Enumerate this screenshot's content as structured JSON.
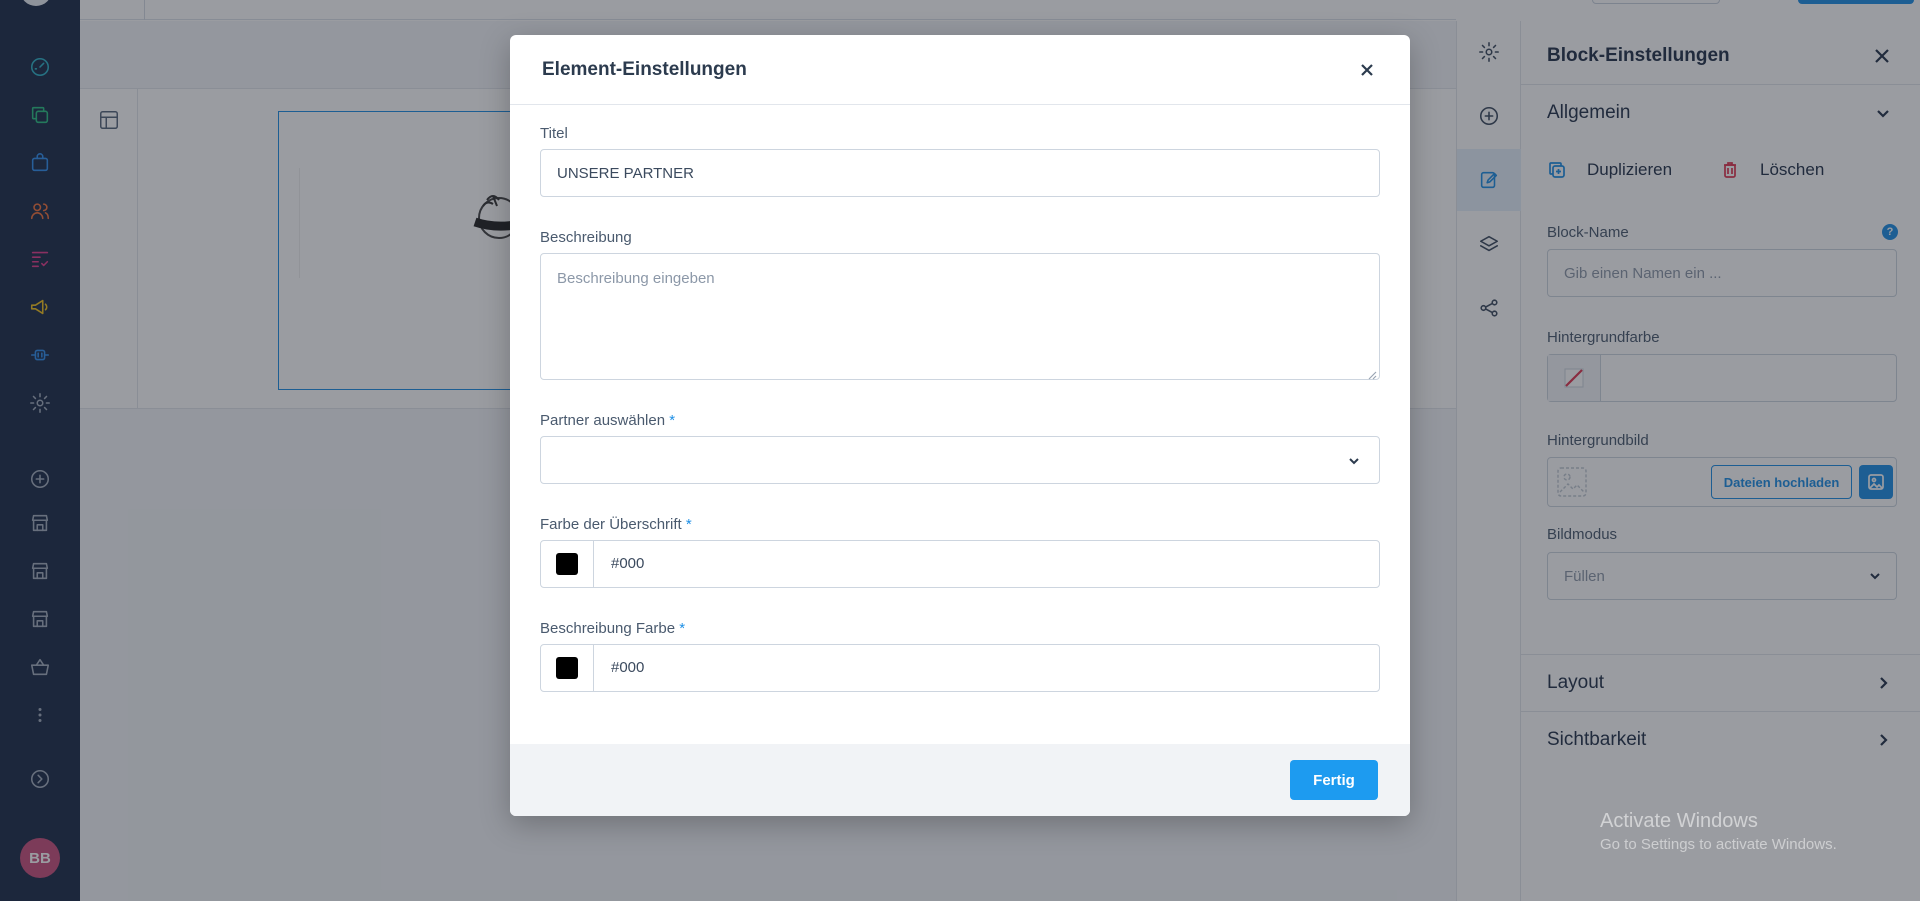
{
  "user": {
    "initials": "BB"
  },
  "colors": {
    "accent": "#1d8fe6",
    "sidebar": "#1b2b48",
    "avatar": "#c94f7c",
    "delete": "#e0334f"
  },
  "sidebar_icons": [
    "dashboard-icon",
    "copy-stack-icon",
    "bag-icon",
    "users-icon",
    "list-check-icon",
    "megaphone-icon",
    "plug-icon",
    "gear-icon",
    "plus-circle-icon",
    "store-icon",
    "store-icon",
    "store-icon",
    "basket-icon",
    "more-vertical-icon",
    "arrow-right-circle-icon"
  ],
  "tool_rail": [
    "gear-icon",
    "plus-circle-icon",
    "edit-icon",
    "layers-icon",
    "share-icon"
  ],
  "panel": {
    "title": "Block-Einstellungen",
    "sections": {
      "general": "Allgemein",
      "layout": "Layout",
      "visibility": "Sichtbarkeit"
    },
    "duplicate_label": "Duplizieren",
    "delete_label": "Löschen",
    "block_name_label": "Block-Name",
    "block_name_help": "?",
    "block_name_placeholder": "Gib einen Namen ein ...",
    "bg_color_label": "Hintergrundfarbe",
    "bg_image_label": "Hintergrundbild",
    "upload_label": "Dateien hochladen",
    "image_mode_label": "Bildmodus",
    "image_mode_value": "Füllen"
  },
  "watermark": {
    "line1": "Activate Windows",
    "line2": "Go to Settings to activate Windows."
  },
  "modal": {
    "title": "Element-Einstellungen",
    "title_field": {
      "label": "Titel",
      "value": "UNSERE PARTNER"
    },
    "description_field": {
      "label": "Beschreibung",
      "placeholder": "Beschreibung eingeben"
    },
    "partner_field": {
      "label": "Partner auswählen",
      "required": "*",
      "value": ""
    },
    "heading_color_field": {
      "label": "Farbe der Überschrift",
      "required": "*",
      "value": "#000",
      "swatch": "#000000"
    },
    "description_color_field": {
      "label": "Beschreibung Farbe",
      "required": "*",
      "value": "#000",
      "swatch": "#000000"
    },
    "done_label": "Fertig"
  }
}
